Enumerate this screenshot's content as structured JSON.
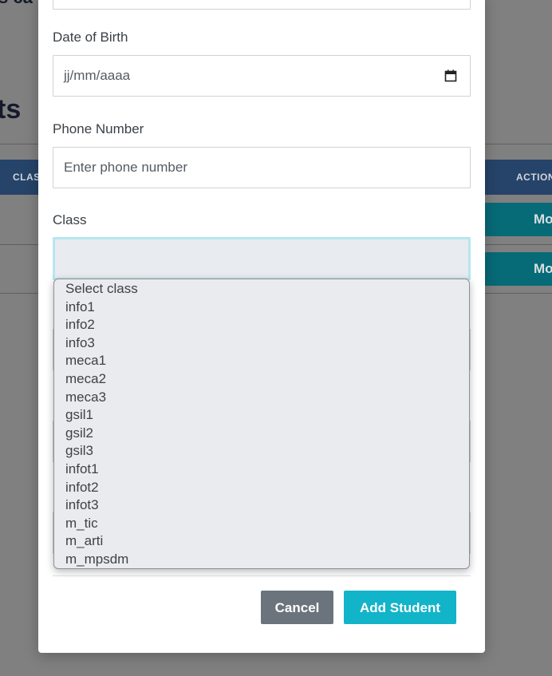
{
  "background": {
    "page_title_fragment": "ts",
    "top_fragment": "s ca",
    "table_headers": {
      "class": "CLAS",
      "actions": "ACTION"
    },
    "row_button_label": "Mo"
  },
  "modal": {
    "dob": {
      "label": "Date of Birth",
      "placeholder": "jj/mm/aaaa"
    },
    "phone": {
      "label": "Phone Number",
      "placeholder": "Enter phone number"
    },
    "class": {
      "label": "Class",
      "selected": "",
      "options": [
        "Select class",
        "info1",
        "info2",
        "info3",
        "meca1",
        "meca2",
        "meca3",
        "gsil1",
        "gsil2",
        "gsil3",
        "infot1",
        "infot2",
        "infot3",
        "m_tic",
        "m_arti",
        "m_mpsdm"
      ]
    },
    "buttons": {
      "cancel": "Cancel",
      "add": "Add Student"
    }
  },
  "colors": {
    "overlay": "#808080",
    "accent": "#12b4c9",
    "cancel": "#6b747c",
    "table_header": "#264369",
    "focus_ring": "#b7e6ef"
  },
  "icons": {
    "date_picker": "calendar-icon"
  }
}
